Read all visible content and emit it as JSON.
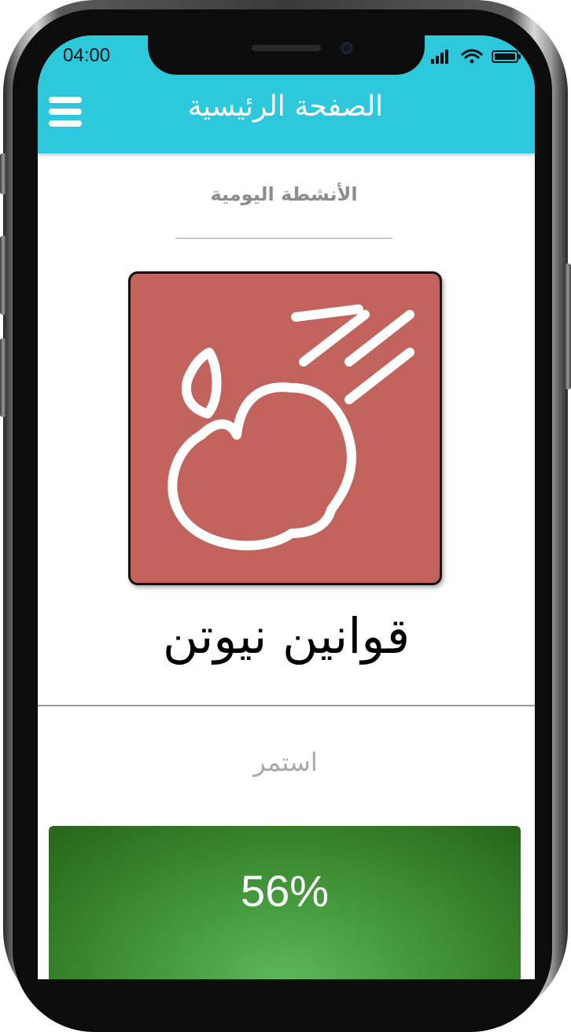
{
  "status_bar": {
    "time": "04:00",
    "icons": [
      "signal-icon",
      "wifi-icon",
      "battery-icon"
    ]
  },
  "app_bar": {
    "title": "الصفحة الرئيسية",
    "menu_icon": "hamburger-menu-icon",
    "background_color": "#2ec8dc"
  },
  "section": {
    "title": "الأنشطة اليومية"
  },
  "activity": {
    "icon": "apple-falling-icon",
    "card_color": "#c2635d",
    "title": "قوانين نيوتن"
  },
  "continue": {
    "label": "استمر"
  },
  "progress": {
    "value": 0.56,
    "label": "56%",
    "color": "#3c8c30"
  }
}
